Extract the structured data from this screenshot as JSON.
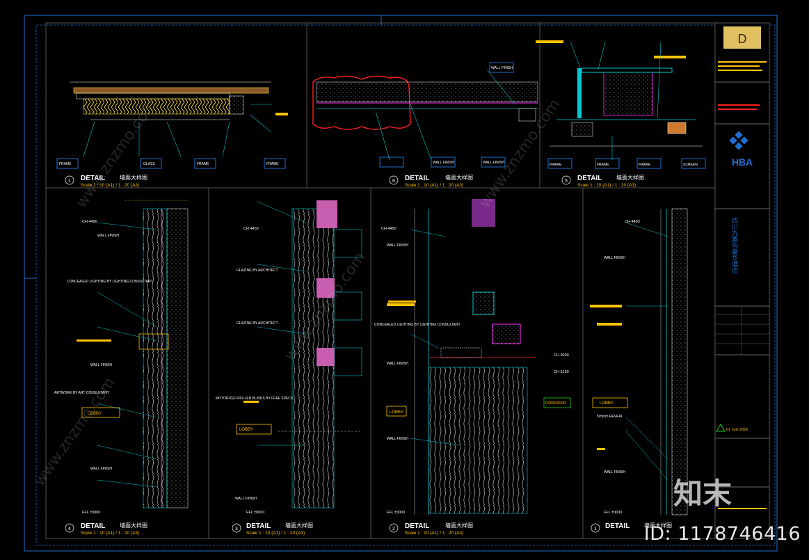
{
  "title_block": {
    "logo_letter": "D",
    "firm": "HBA",
    "project_name": "四川九寨沟豪华酒店",
    "date_note": "01 July 2020"
  },
  "details": [
    {
      "num": "1",
      "title": "DETAIL",
      "title_cn": "墙面大样图",
      "scale": "Scale 1 : 10 (A1) / 1 : 20 (A3)"
    },
    {
      "num": "6",
      "title": "DETAIL",
      "title_cn": "墙面大样图",
      "scale": "Scale 1 : 10 (A1) / 1 : 20 (A3)"
    },
    {
      "num": "5",
      "title": "DETAIL",
      "title_cn": "墙面大样图",
      "scale": "Scale 1 : 10 (A1) / 1 : 20 (A3)"
    },
    {
      "num": "4",
      "title": "DETAIL",
      "title_cn": "墙面大样图",
      "scale": "Scale 1 : 10 (A1) / 1 : 20 (A3)"
    },
    {
      "num": "3",
      "title": "DETAIL",
      "title_cn": "墙面大样图",
      "scale": "Scale 1 : 10 (A1) / 1 : 20 (A3)"
    },
    {
      "num": "2",
      "title": "DETAIL",
      "title_cn": "墙面大样图",
      "scale": "Scale 1 : 10 (A1) / 1 : 20 (A3)"
    },
    {
      "num": "1",
      "title": "DETAIL",
      "title_cn": "墙面大样图",
      "scale": ""
    }
  ],
  "labels": {
    "wall_finish": "WALL FINISH",
    "frame": "FRAME",
    "glass": "GLASS",
    "screen": "SCREEN",
    "lobby": "LOBBY",
    "corridor": "CORRIDOR",
    "ffl": "FFL ±0000",
    "ch1": "CH 4450",
    "ch2": "CH 3000",
    "ch3": "CH 3150",
    "concealed": "CONCEALED LIGHTING BY LIGHTING CONSULTANT",
    "artwork": "ARTWORK BY ART CONSULTANT",
    "glazing": "GLAZING BY ARCHITECT",
    "motorized": "MOTORIZED ROLLER BLINDS BY FF&E SPECS",
    "reveal": "5x5mm REVEAL"
  },
  "watermark": {
    "id_text": "ID: 1178746416",
    "logo_text": "知末",
    "url_text": "www.znzmo.com"
  },
  "colors": {
    "frame": "#1f6fd0",
    "cyan": "#00c8d0",
    "yellow": "#ffc400",
    "magenta": "#ff33ff",
    "red": "#ff2020",
    "green": "#22cc22",
    "white": "#ffffff"
  }
}
